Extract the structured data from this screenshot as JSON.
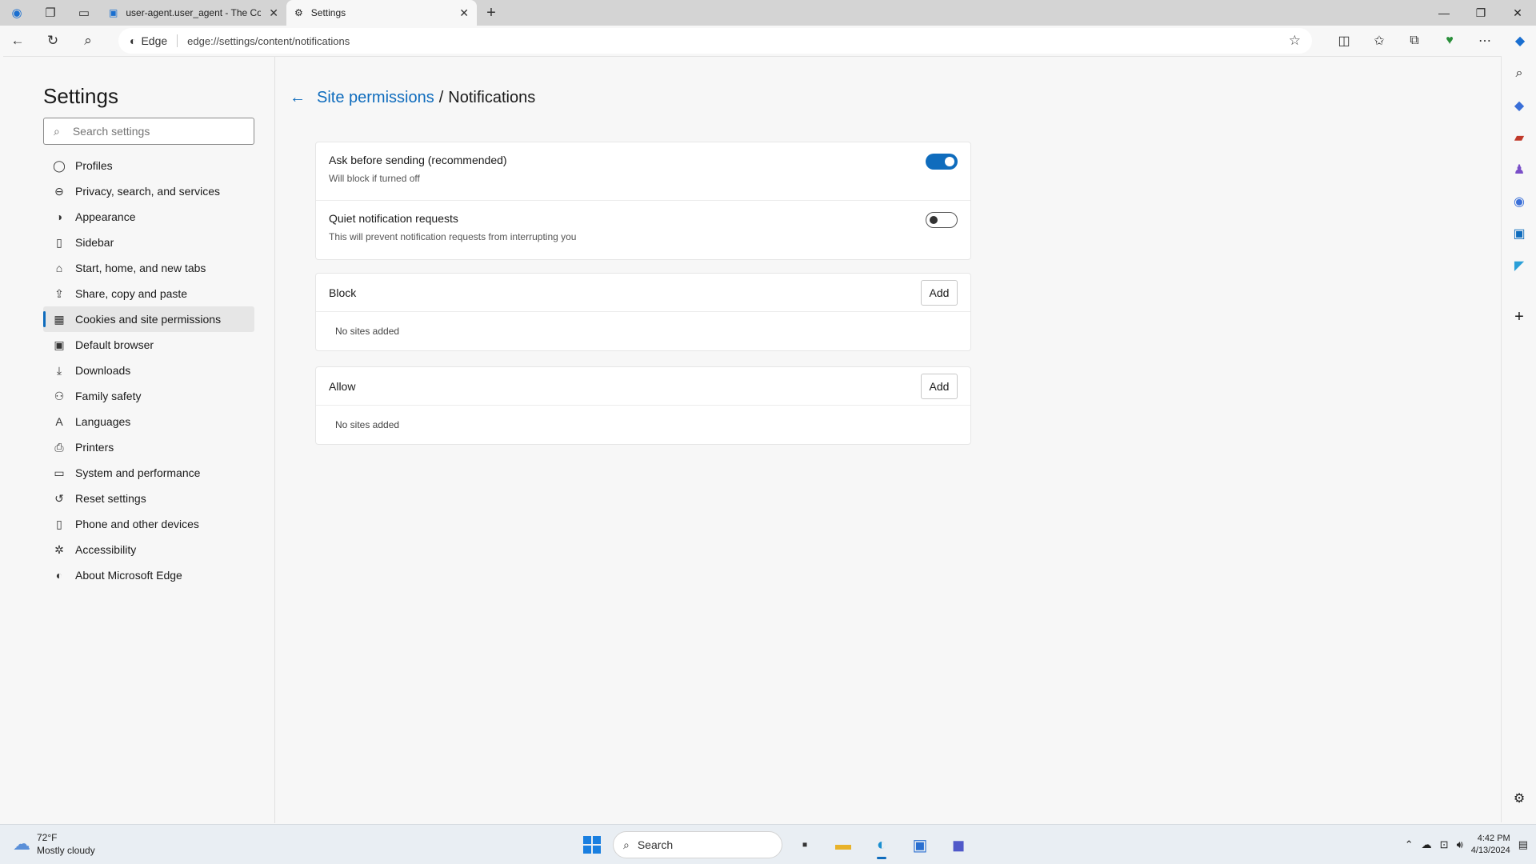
{
  "tabs": [
    {
      "title": "user-agent.user_agent - The Coll",
      "active": false
    },
    {
      "title": "Settings",
      "active": true
    }
  ],
  "address": {
    "site_label": "Edge",
    "url": "edge://settings/content/notifications"
  },
  "settings": {
    "title": "Settings",
    "search_placeholder": "Search settings",
    "nav": [
      {
        "label": "Profiles",
        "icon": "profile-icon"
      },
      {
        "label": "Privacy, search, and services",
        "icon": "lock-icon"
      },
      {
        "label": "Appearance",
        "icon": "appearance-icon"
      },
      {
        "label": "Sidebar",
        "icon": "sidebar-icon"
      },
      {
        "label": "Start, home, and new tabs",
        "icon": "home-icon"
      },
      {
        "label": "Share, copy and paste",
        "icon": "share-icon"
      },
      {
        "label": "Cookies and site permissions",
        "icon": "cookies-icon",
        "selected": true
      },
      {
        "label": "Default browser",
        "icon": "browser-icon"
      },
      {
        "label": "Downloads",
        "icon": "download-icon"
      },
      {
        "label": "Family safety",
        "icon": "family-icon"
      },
      {
        "label": "Languages",
        "icon": "language-icon"
      },
      {
        "label": "Printers",
        "icon": "printer-icon"
      },
      {
        "label": "System and performance",
        "icon": "system-icon"
      },
      {
        "label": "Reset settings",
        "icon": "reset-icon"
      },
      {
        "label": "Phone and other devices",
        "icon": "phone-icon"
      },
      {
        "label": "Accessibility",
        "icon": "accessibility-icon"
      },
      {
        "label": "About Microsoft Edge",
        "icon": "edge-icon"
      }
    ]
  },
  "page": {
    "breadcrumb_parent": "Site permissions",
    "breadcrumb_sep": "/",
    "breadcrumb_current": "Notifications",
    "ask": {
      "title": "Ask before sending (recommended)",
      "sub": "Will block if turned off",
      "enabled": true
    },
    "quiet": {
      "title": "Quiet notification requests",
      "sub": "This will prevent notification requests from interrupting you",
      "enabled": false
    },
    "block": {
      "title": "Block",
      "add": "Add",
      "empty": "No sites added"
    },
    "allow": {
      "title": "Allow",
      "add": "Add",
      "empty": "No sites added"
    }
  },
  "taskbar": {
    "weather_temp": "72°F",
    "weather_desc": "Mostly cloudy",
    "search": "Search",
    "time": "4:42 PM",
    "date": "4/13/2024"
  },
  "colors": {
    "accent": "#0f6cbd",
    "taskbar": "#e9eef3"
  }
}
